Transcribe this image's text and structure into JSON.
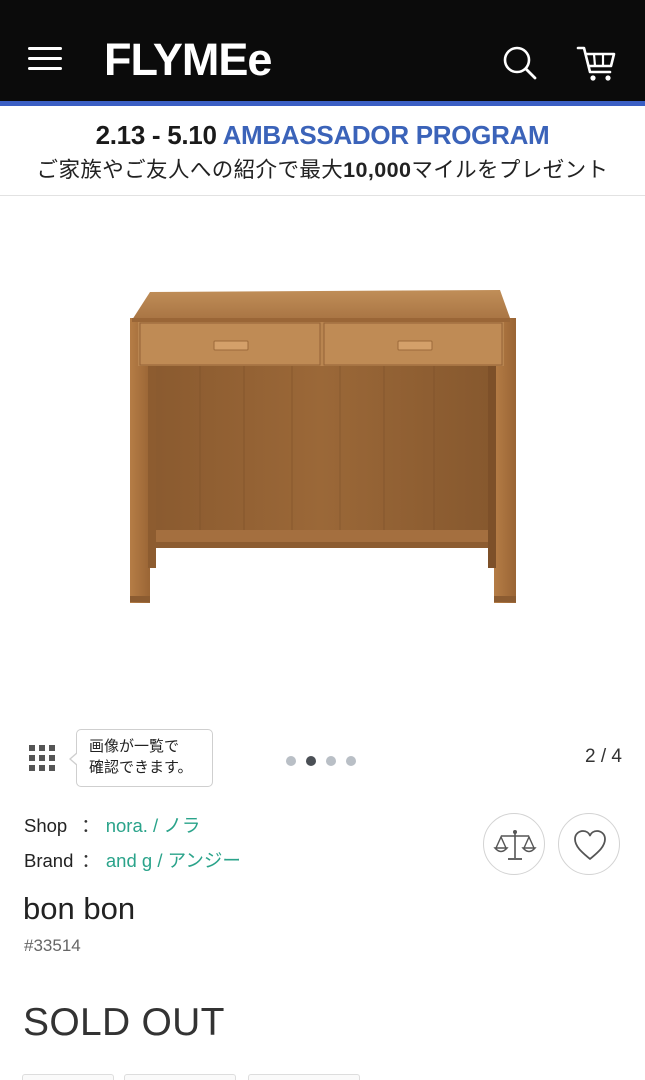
{
  "header": {
    "logo_text": "FLYMEe",
    "menu_icon": "hamburger-menu-icon",
    "search_icon": "search-icon",
    "cart_icon": "cart-icon",
    "background_color": "#0b0b0b",
    "accent_color": "#3b5fc4"
  },
  "banner": {
    "dates": "2.13 - 5.10",
    "program": "AMBASSADOR PROGRAM",
    "subtitle_pre": "ご家族やご友人への紹介で最大",
    "subtitle_bold": "10,000",
    "subtitle_post": "マイルをプレゼント"
  },
  "gallery": {
    "image_alt": "Wooden desk with two drawers",
    "grid_icon": "grid-icon",
    "tooltip_line1": "画像が一覧で",
    "tooltip_line2": "確認できます。",
    "dots_total": 4,
    "active_dot": 2,
    "counter": "2 / 4"
  },
  "product": {
    "shop_label": "Shop",
    "shop_value": "nora. / ノラ",
    "brand_label": "Brand",
    "brand_value": "and g / アンジー",
    "separator": "：",
    "title": "bon bon",
    "id": "#33514",
    "status": "SOLD OUT",
    "link_color": "#2aa38a"
  },
  "actions": {
    "compare_icon": "scale-compare-icon",
    "favorite_icon": "heart-icon"
  }
}
